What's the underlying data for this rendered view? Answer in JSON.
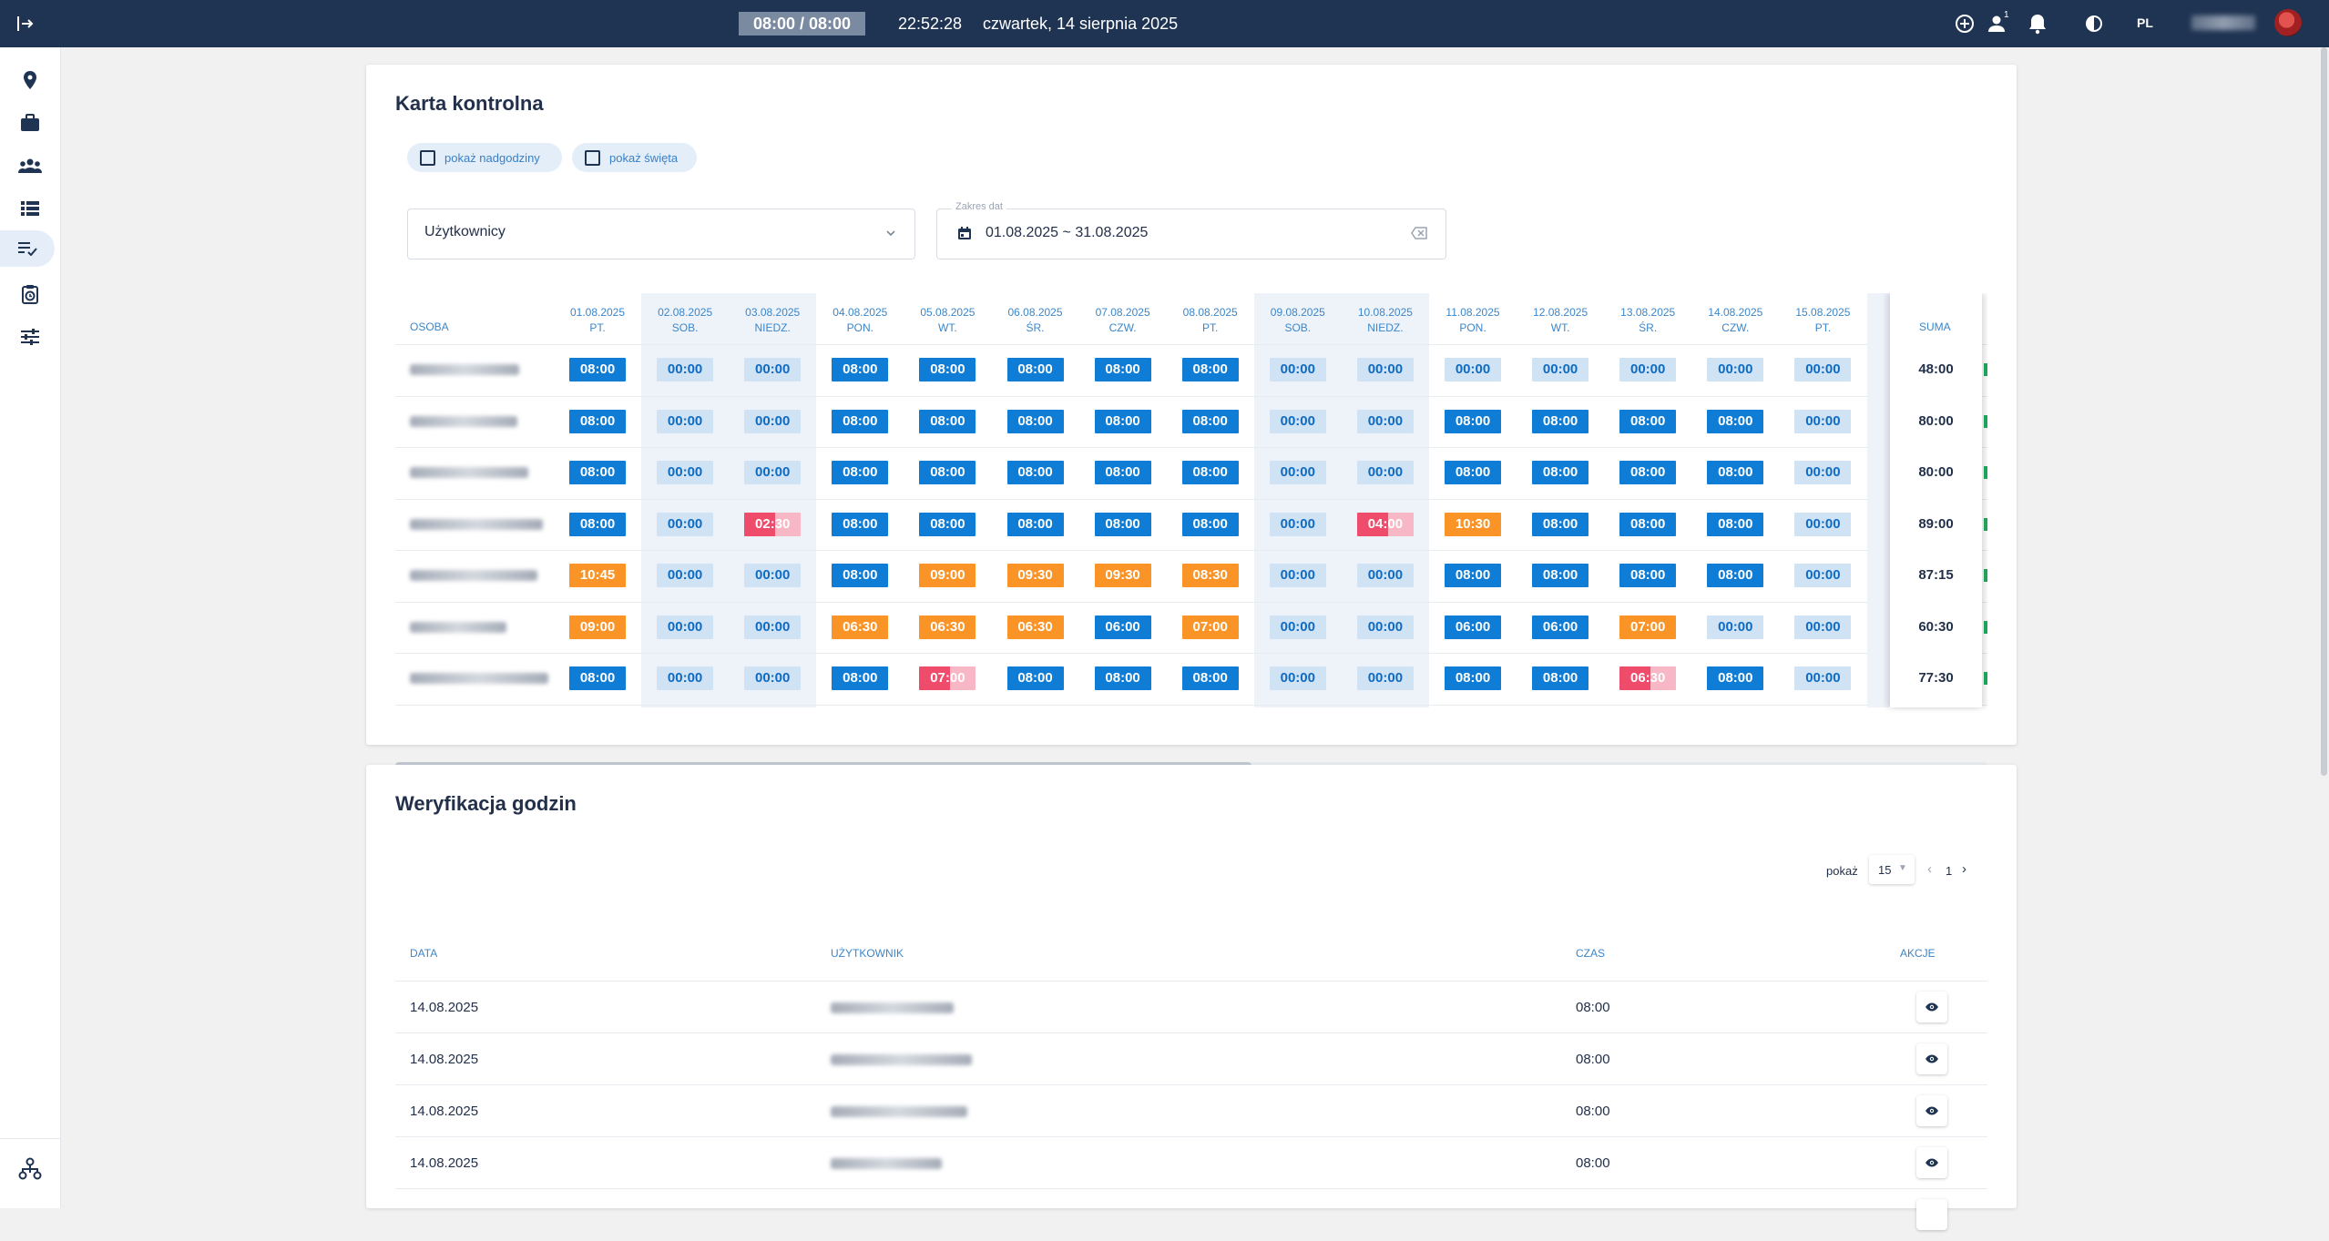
{
  "topbar": {
    "shift": "08:00 / 08:00",
    "clock": "22:52:28",
    "date": "czwartek, 14 sierpnia 2025",
    "notification_count": "1",
    "lang": "PL"
  },
  "sidebar": {
    "items": [
      "location-icon",
      "briefcase-icon",
      "people-icon",
      "list-icon",
      "checklist-icon",
      "clipboard-clock-icon",
      "sliders-icon"
    ],
    "active_index": 4
  },
  "karta": {
    "title": "Karta kontrolna",
    "chip_overtime": "pokaż nadgodziny",
    "chip_holidays": "pokaż święta",
    "users_select": "Użytkownicy",
    "date_label": "Zakres dat",
    "date_value": "01.08.2025 ~ 31.08.2025",
    "osoba_header": "OSOBA",
    "suma_header": "SUMA",
    "days": [
      {
        "date": "01.08.2025",
        "dow": "PT.",
        "weekend": false
      },
      {
        "date": "02.08.2025",
        "dow": "SOB.",
        "weekend": true
      },
      {
        "date": "03.08.2025",
        "dow": "NIEDZ.",
        "weekend": true
      },
      {
        "date": "04.08.2025",
        "dow": "PON.",
        "weekend": false
      },
      {
        "date": "05.08.2025",
        "dow": "WT.",
        "weekend": false
      },
      {
        "date": "06.08.2025",
        "dow": "ŚR.",
        "weekend": false
      },
      {
        "date": "07.08.2025",
        "dow": "CZW.",
        "weekend": false
      },
      {
        "date": "08.08.2025",
        "dow": "PT.",
        "weekend": false
      },
      {
        "date": "09.08.2025",
        "dow": "SOB.",
        "weekend": true
      },
      {
        "date": "10.08.2025",
        "dow": "NIEDZ.",
        "weekend": true
      },
      {
        "date": "11.08.2025",
        "dow": "PON.",
        "weekend": false
      },
      {
        "date": "12.08.2025",
        "dow": "WT.",
        "weekend": false
      },
      {
        "date": "13.08.2025",
        "dow": "ŚR.",
        "weekend": false
      },
      {
        "date": "14.08.2025",
        "dow": "CZW.",
        "weekend": false
      },
      {
        "date": "15.08.2025",
        "dow": "PT.",
        "weekend": false
      }
    ],
    "rows": [
      {
        "sum": "48:00",
        "cells": [
          [
            "08:00",
            "b"
          ],
          [
            "00:00",
            "l"
          ],
          [
            "00:00",
            "l"
          ],
          [
            "08:00",
            "b"
          ],
          [
            "08:00",
            "b"
          ],
          [
            "08:00",
            "b"
          ],
          [
            "08:00",
            "b"
          ],
          [
            "08:00",
            "b"
          ],
          [
            "00:00",
            "l"
          ],
          [
            "00:00",
            "l"
          ],
          [
            "00:00",
            "l"
          ],
          [
            "00:00",
            "l"
          ],
          [
            "00:00",
            "l"
          ],
          [
            "00:00",
            "l"
          ],
          [
            "00:00",
            "l"
          ]
        ]
      },
      {
        "sum": "80:00",
        "cells": [
          [
            "08:00",
            "b"
          ],
          [
            "00:00",
            "l"
          ],
          [
            "00:00",
            "l"
          ],
          [
            "08:00",
            "b"
          ],
          [
            "08:00",
            "b"
          ],
          [
            "08:00",
            "b"
          ],
          [
            "08:00",
            "b"
          ],
          [
            "08:00",
            "b"
          ],
          [
            "00:00",
            "l"
          ],
          [
            "00:00",
            "l"
          ],
          [
            "08:00",
            "b"
          ],
          [
            "08:00",
            "b"
          ],
          [
            "08:00",
            "b"
          ],
          [
            "08:00",
            "b"
          ],
          [
            "00:00",
            "l"
          ]
        ]
      },
      {
        "sum": "80:00",
        "cells": [
          [
            "08:00",
            "b"
          ],
          [
            "00:00",
            "l"
          ],
          [
            "00:00",
            "l"
          ],
          [
            "08:00",
            "b"
          ],
          [
            "08:00",
            "b"
          ],
          [
            "08:00",
            "b"
          ],
          [
            "08:00",
            "b"
          ],
          [
            "08:00",
            "b"
          ],
          [
            "00:00",
            "l"
          ],
          [
            "00:00",
            "l"
          ],
          [
            "08:00",
            "b"
          ],
          [
            "08:00",
            "b"
          ],
          [
            "08:00",
            "b"
          ],
          [
            "08:00",
            "b"
          ],
          [
            "00:00",
            "l"
          ]
        ]
      },
      {
        "sum": "89:00",
        "cells": [
          [
            "08:00",
            "b"
          ],
          [
            "00:00",
            "l"
          ],
          [
            "02:30",
            "r"
          ],
          [
            "08:00",
            "b"
          ],
          [
            "08:00",
            "b"
          ],
          [
            "08:00",
            "b"
          ],
          [
            "08:00",
            "b"
          ],
          [
            "08:00",
            "b"
          ],
          [
            "00:00",
            "l"
          ],
          [
            "04:00",
            "r"
          ],
          [
            "10:30",
            "o"
          ],
          [
            "08:00",
            "b"
          ],
          [
            "08:00",
            "b"
          ],
          [
            "08:00",
            "b"
          ],
          [
            "00:00",
            "l"
          ]
        ]
      },
      {
        "sum": "87:15",
        "cells": [
          [
            "10:45",
            "o"
          ],
          [
            "00:00",
            "l"
          ],
          [
            "00:00",
            "l"
          ],
          [
            "08:00",
            "b"
          ],
          [
            "09:00",
            "o"
          ],
          [
            "09:30",
            "o"
          ],
          [
            "09:30",
            "o"
          ],
          [
            "08:30",
            "o"
          ],
          [
            "00:00",
            "l"
          ],
          [
            "00:00",
            "l"
          ],
          [
            "08:00",
            "b"
          ],
          [
            "08:00",
            "b"
          ],
          [
            "08:00",
            "b"
          ],
          [
            "08:00",
            "b"
          ],
          [
            "00:00",
            "l"
          ]
        ]
      },
      {
        "sum": "60:30",
        "cells": [
          [
            "09:00",
            "o"
          ],
          [
            "00:00",
            "l"
          ],
          [
            "00:00",
            "l"
          ],
          [
            "06:30",
            "o"
          ],
          [
            "06:30",
            "o"
          ],
          [
            "06:30",
            "o"
          ],
          [
            "06:00",
            "b"
          ],
          [
            "07:00",
            "o"
          ],
          [
            "00:00",
            "l"
          ],
          [
            "00:00",
            "l"
          ],
          [
            "06:00",
            "b"
          ],
          [
            "06:00",
            "b"
          ],
          [
            "07:00",
            "o"
          ],
          [
            "00:00",
            "l"
          ],
          [
            "00:00",
            "l"
          ]
        ]
      },
      {
        "sum": "77:30",
        "cells": [
          [
            "08:00",
            "b"
          ],
          [
            "00:00",
            "l"
          ],
          [
            "00:00",
            "l"
          ],
          [
            "08:00",
            "b"
          ],
          [
            "07:00",
            "r"
          ],
          [
            "08:00",
            "b"
          ],
          [
            "08:00",
            "b"
          ],
          [
            "08:00",
            "b"
          ],
          [
            "00:00",
            "l"
          ],
          [
            "00:00",
            "l"
          ],
          [
            "08:00",
            "b"
          ],
          [
            "08:00",
            "b"
          ],
          [
            "06:30",
            "r"
          ],
          [
            "08:00",
            "b"
          ],
          [
            "00:00",
            "l"
          ]
        ]
      }
    ]
  },
  "weryfikacja": {
    "title": "Weryfikacja godzin",
    "pager_label": "pokaż",
    "page_size": "15",
    "page": "1",
    "headers": {
      "date": "DATA",
      "user": "UŻYTKOWNIK",
      "time": "CZAS",
      "actions": "AKCJE"
    },
    "rows": [
      {
        "date": "14.08.2025",
        "time": "08:00"
      },
      {
        "date": "14.08.2025",
        "time": "08:00"
      },
      {
        "date": "14.08.2025",
        "time": "08:00"
      },
      {
        "date": "14.08.2025",
        "time": "08:00"
      }
    ]
  },
  "colors": {
    "topbar": "#1f3453",
    "blue": "#0f7cd6",
    "light": "#cfe3f5",
    "orange": "#fa9427",
    "red": "#ef4b6a",
    "accent": "#3b86c9"
  }
}
